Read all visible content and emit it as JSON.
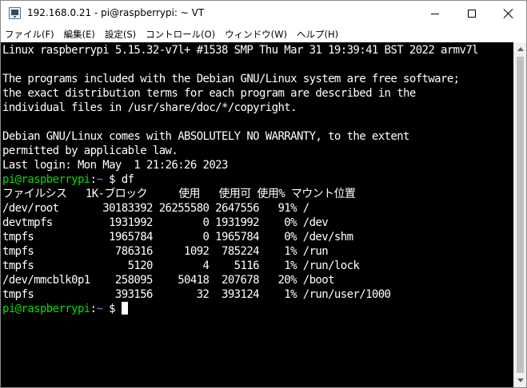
{
  "window": {
    "title": "192.168.0.21 - pi@raspberrypi: ~ VT"
  },
  "menu": [
    "ファイル(F)",
    "編集(E)",
    "設定(S)",
    "コントロール(O)",
    "ウィンドウ(W)",
    "ヘルプ(H)"
  ],
  "terminal": {
    "lines": [
      "Linux raspberrypi 5.15.32-v7l+ #1538 SMP Thu Mar 31 19:39:41 BST 2022 armv7l",
      "",
      "The programs included with the Debian GNU/Linux system are free software;",
      "the exact distribution terms for each program are described in the",
      "individual files in /usr/share/doc/*/copyright.",
      "",
      "Debian GNU/Linux comes with ABSOLUTELY NO WARRANTY, to the extent",
      "permitted by applicable law.",
      "Last login: Mon May  1 21:26:26 2023"
    ],
    "prompt1": {
      "user": "pi@raspberrypi",
      "sep": ":",
      "path": "~",
      "symbol": " $ ",
      "command": "df"
    },
    "df_output": [
      "ファイルシス   1K-ブロック     使用   使用可 使用% マウント位置",
      "/dev/root       30183392 26255580 2647556   91% /",
      "devtmpfs         1931992        0 1931992    0% /dev",
      "tmpfs            1965784        0 1965784    0% /dev/shm",
      "tmpfs             786316     1092  785224    1% /run",
      "tmpfs               5120        4    5116    1% /run/lock",
      "/dev/mmcblk0p1    258095    50418  207678   20% /boot",
      "tmpfs             393156       32  393124    1% /run/user/1000"
    ],
    "prompt2": {
      "user": "pi@raspberrypi",
      "sep": ":",
      "path": "~",
      "symbol": " $ "
    }
  },
  "colors": {
    "prompt_user": "#00e000",
    "prompt_path": "#6a8cff",
    "terminal_bg": "#000000",
    "terminal_fg": "#ffffff"
  }
}
